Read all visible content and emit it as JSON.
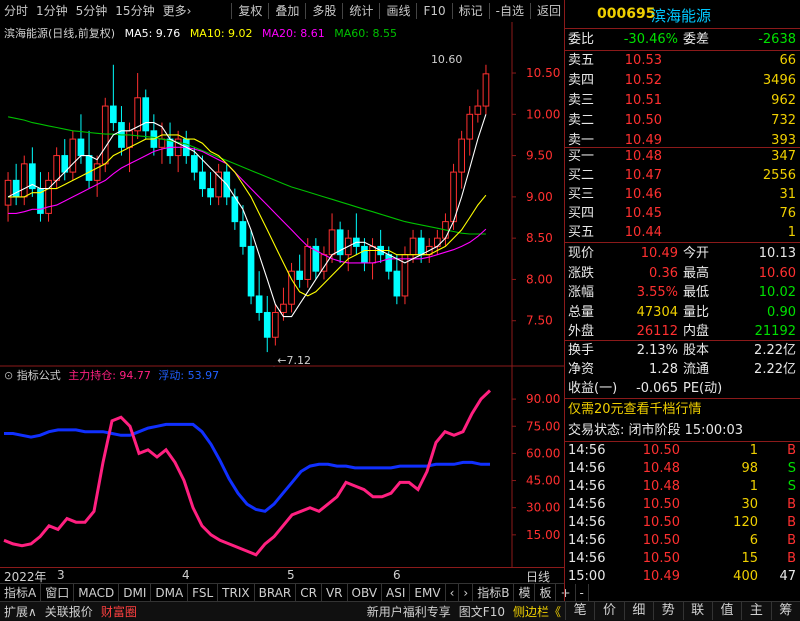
{
  "toolbar": {
    "left_items": [
      "分时",
      "1分钟",
      "5分钟",
      "15分钟",
      "更多›"
    ],
    "right_items": [
      "复权",
      "叠加",
      "多股",
      "统计",
      "画线",
      "F10",
      "标记",
      "-自选",
      "返回"
    ]
  },
  "stock": {
    "code": "000695",
    "name": "滨海能源"
  },
  "main_legend": {
    "title": "滨海能源(日线,前复权)",
    "ma5": "MA5: 9.76",
    "ma10": "MA10: 9.02",
    "ma20": "MA20: 8.61",
    "ma60": "MA60: 8.55",
    "colors": {
      "ma5": "#ffffff",
      "ma10": "#ffff00",
      "ma20": "#ff00ff",
      "ma60": "#00c000",
      "up": "#ff3030",
      "down": "#00ffff"
    }
  },
  "main_annotations": {
    "high_label": "10.60",
    "low_label": "7.12",
    "cai_label": "财"
  },
  "price_axis": [
    "10.50",
    "10.00",
    "9.50",
    "9.00",
    "8.50",
    "8.00",
    "7.50"
  ],
  "ind_legend": {
    "title": "指标公式",
    "zlcc": "主力持仓: 94.77",
    "jd": "浮动: 53.97"
  },
  "ind_axis": [
    "90.00",
    "75.00",
    "60.00",
    "45.00",
    "30.00",
    "15.00"
  ],
  "date_axis": {
    "year": "2022年",
    "months": [
      "3",
      "4",
      "5",
      "6"
    ],
    "right_label": "日线"
  },
  "chart_data": {
    "type": "line",
    "main_ylim": [
      7.0,
      10.9
    ],
    "ind_ylim": [
      0,
      100
    ],
    "candles": [
      [
        8.9,
        9.3,
        8.7,
        9.2
      ],
      [
        9.2,
        9.4,
        8.9,
        9.0
      ],
      [
        9.0,
        9.5,
        8.9,
        9.4
      ],
      [
        9.4,
        9.6,
        9.0,
        9.1
      ],
      [
        9.1,
        9.3,
        8.7,
        8.8
      ],
      [
        8.8,
        9.3,
        8.7,
        9.2
      ],
      [
        9.2,
        9.6,
        9.1,
        9.5
      ],
      [
        9.5,
        9.7,
        9.2,
        9.3
      ],
      [
        9.3,
        9.8,
        9.2,
        9.7
      ],
      [
        9.7,
        10.0,
        9.4,
        9.5
      ],
      [
        9.5,
        9.8,
        9.1,
        9.2
      ],
      [
        9.2,
        9.5,
        9.0,
        9.4
      ],
      [
        9.4,
        10.2,
        9.3,
        10.1
      ],
      [
        10.1,
        10.6,
        9.8,
        9.9
      ],
      [
        9.9,
        10.1,
        9.5,
        9.6
      ],
      [
        9.6,
        9.9,
        9.3,
        9.8
      ],
      [
        9.8,
        10.5,
        9.7,
        10.2
      ],
      [
        10.2,
        10.3,
        9.7,
        9.8
      ],
      [
        9.8,
        10.0,
        9.5,
        9.6
      ],
      [
        9.6,
        9.9,
        9.4,
        9.7
      ],
      [
        9.7,
        9.9,
        9.4,
        9.5
      ],
      [
        9.5,
        9.8,
        9.3,
        9.7
      ],
      [
        9.7,
        9.8,
        9.4,
        9.5
      ],
      [
        9.5,
        9.6,
        9.2,
        9.3
      ],
      [
        9.3,
        9.5,
        9.0,
        9.1
      ],
      [
        9.1,
        9.3,
        8.9,
        9.0
      ],
      [
        9.0,
        9.4,
        8.9,
        9.3
      ],
      [
        9.3,
        9.4,
        8.9,
        9.0
      ],
      [
        9.0,
        9.1,
        8.6,
        8.7
      ],
      [
        8.7,
        8.9,
        8.3,
        8.4
      ],
      [
        8.4,
        8.6,
        7.7,
        7.8
      ],
      [
        7.8,
        8.1,
        7.5,
        7.6
      ],
      [
        7.6,
        7.8,
        7.12,
        7.3
      ],
      [
        7.3,
        7.7,
        7.2,
        7.6
      ],
      [
        7.6,
        7.9,
        7.5,
        7.7
      ],
      [
        7.7,
        8.2,
        7.6,
        8.1
      ],
      [
        8.1,
        8.3,
        7.9,
        8.0
      ],
      [
        8.0,
        8.5,
        7.9,
        8.4
      ],
      [
        8.4,
        8.5,
        8.0,
        8.1
      ],
      [
        8.1,
        8.4,
        8.0,
        8.3
      ],
      [
        8.3,
        8.8,
        8.2,
        8.6
      ],
      [
        8.6,
        8.7,
        8.2,
        8.3
      ],
      [
        8.3,
        8.6,
        8.1,
        8.5
      ],
      [
        8.5,
        8.8,
        8.3,
        8.4
      ],
      [
        8.4,
        8.5,
        8.1,
        8.2
      ],
      [
        8.2,
        8.5,
        8.0,
        8.4
      ],
      [
        8.4,
        8.6,
        8.2,
        8.3
      ],
      [
        8.3,
        8.4,
        8.0,
        8.1
      ],
      [
        8.1,
        8.3,
        7.7,
        7.8
      ],
      [
        7.8,
        8.4,
        7.7,
        8.3
      ],
      [
        8.3,
        8.6,
        8.2,
        8.5
      ],
      [
        8.5,
        8.6,
        8.2,
        8.3
      ],
      [
        8.3,
        8.5,
        8.2,
        8.4
      ],
      [
        8.4,
        8.6,
        8.3,
        8.5
      ],
      [
        8.5,
        8.8,
        8.4,
        8.7
      ],
      [
        8.7,
        9.4,
        8.6,
        9.3
      ],
      [
        9.3,
        9.8,
        9.1,
        9.7
      ],
      [
        9.7,
        10.1,
        9.5,
        10.0
      ],
      [
        10.0,
        10.3,
        9.9,
        10.1
      ],
      [
        10.1,
        10.6,
        10.0,
        10.49
      ]
    ],
    "ma5": [
      9.0,
      9.05,
      9.1,
      9.15,
      9.1,
      9.1,
      9.2,
      9.3,
      9.4,
      9.5,
      9.5,
      9.45,
      9.6,
      9.75,
      9.8,
      9.8,
      9.85,
      9.9,
      9.9,
      9.85,
      9.7,
      9.65,
      9.6,
      9.55,
      9.45,
      9.35,
      9.25,
      9.15,
      9.0,
      8.85,
      8.6,
      8.3,
      8.0,
      7.7,
      7.55,
      7.55,
      7.7,
      7.85,
      8.0,
      8.15,
      8.3,
      8.35,
      8.4,
      8.45,
      8.45,
      8.4,
      8.35,
      8.3,
      8.25,
      8.2,
      8.25,
      8.3,
      8.35,
      8.4,
      8.5,
      8.7,
      9.0,
      9.35,
      9.7,
      10.0
    ],
    "ma10": [
      9.0,
      9.0,
      9.0,
      9.05,
      9.05,
      9.1,
      9.1,
      9.15,
      9.2,
      9.25,
      9.3,
      9.35,
      9.4,
      9.5,
      9.55,
      9.6,
      9.65,
      9.7,
      9.7,
      9.75,
      9.75,
      9.75,
      9.7,
      9.7,
      9.65,
      9.55,
      9.5,
      9.4,
      9.3,
      9.15,
      9.0,
      8.8,
      8.6,
      8.4,
      8.2,
      8.0,
      7.85,
      7.8,
      7.85,
      7.95,
      8.05,
      8.15,
      8.25,
      8.3,
      8.35,
      8.35,
      8.35,
      8.35,
      8.3,
      8.3,
      8.3,
      8.3,
      8.3,
      8.35,
      8.4,
      8.5,
      8.6,
      8.75,
      8.9,
      9.02
    ],
    "ma20": [
      8.8,
      8.8,
      8.82,
      8.85,
      8.85,
      8.88,
      8.9,
      8.95,
      9.0,
      9.05,
      9.1,
      9.15,
      9.2,
      9.28,
      9.35,
      9.4,
      9.45,
      9.5,
      9.55,
      9.58,
      9.6,
      9.6,
      9.6,
      9.58,
      9.55,
      9.5,
      9.45,
      9.4,
      9.3,
      9.2,
      9.1,
      9.0,
      8.9,
      8.8,
      8.7,
      8.6,
      8.5,
      8.4,
      8.35,
      8.3,
      8.25,
      8.22,
      8.2,
      8.2,
      8.2,
      8.2,
      8.22,
      8.25,
      8.25,
      8.25,
      8.25,
      8.25,
      8.27,
      8.3,
      8.33,
      8.36,
      8.4,
      8.45,
      8.52,
      8.61
    ],
    "ma60": [
      9.97,
      9.95,
      9.93,
      9.9,
      9.88,
      9.86,
      9.84,
      9.82,
      9.8,
      9.79,
      9.78,
      9.77,
      9.76,
      9.76,
      9.75,
      9.75,
      9.74,
      9.73,
      9.72,
      9.7,
      9.68,
      9.66,
      9.64,
      9.6,
      9.56,
      9.52,
      9.48,
      9.44,
      9.4,
      9.36,
      9.32,
      9.28,
      9.24,
      9.2,
      9.16,
      9.12,
      9.09,
      9.06,
      9.03,
      9.0,
      8.97,
      8.94,
      8.91,
      8.88,
      8.85,
      8.82,
      8.79,
      8.76,
      8.73,
      8.7,
      8.68,
      8.66,
      8.64,
      8.62,
      8.6,
      8.58,
      8.56,
      8.55,
      8.55,
      8.55
    ],
    "zlcc": [
      12,
      10,
      9,
      10,
      14,
      20,
      18,
      24,
      22,
      22,
      28,
      55,
      78,
      80,
      75,
      60,
      62,
      58,
      62,
      55,
      45,
      30,
      20,
      15,
      12,
      10,
      8,
      6,
      4,
      10,
      14,
      20,
      26,
      28,
      30,
      28,
      32,
      36,
      44,
      42,
      40,
      36,
      36,
      38,
      44,
      44,
      40,
      50,
      66,
      72,
      70,
      72,
      82,
      90,
      94.77
    ],
    "jd": [
      71,
      71,
      70,
      69,
      70,
      72,
      73,
      73,
      73,
      72,
      72,
      72,
      71,
      70,
      70,
      72,
      74,
      75,
      76,
      76,
      76,
      76,
      72,
      65,
      56,
      46,
      38,
      32,
      29,
      28,
      32,
      38,
      44,
      50,
      53,
      54,
      54,
      53,
      53,
      52,
      52,
      52,
      52,
      52,
      53,
      53,
      53,
      53,
      54,
      54,
      54,
      55,
      55,
      54,
      53.97
    ]
  },
  "quote": {
    "weibi": {
      "label": "委比",
      "value": "-30.46%",
      "label2": "委差",
      "value2": "-2638"
    },
    "sell": [
      {
        "label": "卖五",
        "price": "10.53",
        "vol": "66"
      },
      {
        "label": "卖四",
        "price": "10.52",
        "vol": "3496"
      },
      {
        "label": "卖三",
        "price": "10.51",
        "vol": "962"
      },
      {
        "label": "卖二",
        "price": "10.50",
        "vol": "732"
      },
      {
        "label": "卖一",
        "price": "10.49",
        "vol": "393"
      }
    ],
    "buy": [
      {
        "label": "买一",
        "price": "10.48",
        "vol": "347"
      },
      {
        "label": "买二",
        "price": "10.47",
        "vol": "2556"
      },
      {
        "label": "买三",
        "price": "10.46",
        "vol": "31"
      },
      {
        "label": "买四",
        "price": "10.45",
        "vol": "76"
      },
      {
        "label": "买五",
        "price": "10.44",
        "vol": "1"
      }
    ],
    "stats": [
      {
        "l1": "现价",
        "v1": "10.49",
        "l2": "今开",
        "v2": "10.13",
        "c1": "red",
        "c2": "white"
      },
      {
        "l1": "涨跌",
        "v1": "0.36",
        "l2": "最高",
        "v2": "10.60",
        "c1": "red",
        "c2": "red"
      },
      {
        "l1": "涨幅",
        "v1": "3.55%",
        "l2": "最低",
        "v2": "10.02",
        "c1": "red",
        "c2": "green"
      },
      {
        "l1": "总量",
        "v1": "47304",
        "l2": "量比",
        "v2": "0.90",
        "c1": "yellow",
        "c2": "green"
      },
      {
        "l1": "外盘",
        "v1": "26112",
        "l2": "内盘",
        "v2": "21192",
        "c1": "red",
        "c2": "green"
      }
    ],
    "stats2": [
      {
        "l1": "换手",
        "v1": "2.13%",
        "l2": "股本",
        "v2": "2.22亿"
      },
      {
        "l1": "净资",
        "v1": "1.28",
        "l2": "流通",
        "v2": "2.22亿"
      },
      {
        "l1": "收益(一)",
        "v1": "-0.065",
        "l2": "PE(动)",
        "v2": ""
      }
    ],
    "promo": "仅需20元查看千档行情",
    "trade_state": "交易状态: 闭市阶段 15:00:03",
    "ticks": [
      {
        "t": "14:56",
        "p": "10.50",
        "v": "1",
        "bs": "B",
        "vc": "yellow",
        "bc": "red"
      },
      {
        "t": "14:56",
        "p": "10.48",
        "v": "98",
        "bs": "S",
        "vc": "yellow",
        "bc": "green"
      },
      {
        "t": "14:56",
        "p": "10.48",
        "v": "1",
        "bs": "S",
        "vc": "yellow",
        "bc": "green"
      },
      {
        "t": "14:56",
        "p": "10.50",
        "v": "30",
        "bs": "B",
        "vc": "yellow",
        "bc": "red"
      },
      {
        "t": "14:56",
        "p": "10.50",
        "v": "120",
        "bs": "B",
        "vc": "yellow",
        "bc": "red"
      },
      {
        "t": "14:56",
        "p": "10.50",
        "v": "6",
        "bs": "B",
        "vc": "yellow",
        "bc": "red"
      },
      {
        "t": "14:56",
        "p": "10.50",
        "v": "15",
        "bs": "B",
        "vc": "yellow",
        "bc": "red"
      },
      {
        "t": "15:00",
        "p": "10.49",
        "v": "400",
        "bs": "47",
        "vc": "yellow",
        "bc": "white"
      }
    ]
  },
  "bottom_tabs": [
    "指标A",
    "窗口",
    "MACD",
    "DMI",
    "DMA",
    "FSL",
    "TRIX",
    "BRAR",
    "CR",
    "VR",
    "OBV",
    "ASI",
    "EMV",
    "‹",
    "›",
    "指标B",
    "模",
    "板",
    "+",
    "-"
  ],
  "status_bar": {
    "left": [
      "扩展∧",
      "关联报价",
      "财富圈"
    ],
    "middle": [
      "新用户福利专享",
      "图文F10",
      "侧边栏《"
    ]
  },
  "right_icons": [
    "笔",
    "价",
    "细",
    "势",
    "联",
    "值",
    "主",
    "筹"
  ]
}
